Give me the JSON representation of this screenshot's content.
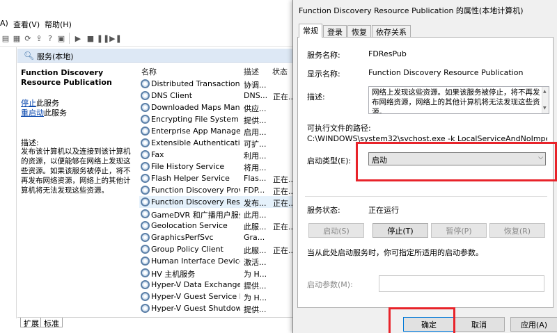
{
  "services_window": {
    "menu": {
      "partial": "A)",
      "view": "查看(V)",
      "help": "帮助(H)"
    },
    "panel_title": "服务(本地)",
    "selected_service": {
      "name": "Function Discovery Resource Publication",
      "stop_link": "停止",
      "stop_suffix": "此服务",
      "restart_link": "重启动",
      "restart_suffix": "此服务",
      "desc_label": "描述:",
      "description": "发布该计算机以及连接到该计算机的资源，以便能够在网络上发现这些资源。如果该服务被停止，将不再发布网络资源，网络上的其他计算机将无法发现这些资源。"
    },
    "columns": {
      "name": "名称",
      "desc": "描述",
      "status": "状态"
    },
    "rows": [
      {
        "name": "Distributed Transaction C...",
        "desc": "协调...",
        "status": ""
      },
      {
        "name": "DNS Client",
        "desc": "DNS...",
        "status": "正在..."
      },
      {
        "name": "Downloaded Maps Man...",
        "desc": "供应...",
        "status": ""
      },
      {
        "name": "Encrypting File System (E...",
        "desc": "提供...",
        "status": ""
      },
      {
        "name": "Enterprise App Manage...",
        "desc": "启用...",
        "status": ""
      },
      {
        "name": "Extensible Authenticati...",
        "desc": "可扩...",
        "status": ""
      },
      {
        "name": "Fax",
        "desc": "利用...",
        "status": ""
      },
      {
        "name": "File History Service",
        "desc": "将用...",
        "status": ""
      },
      {
        "name": "Flash Helper Service",
        "desc": "Flas...",
        "status": "正在..."
      },
      {
        "name": "Function Discovery Provi...",
        "desc": "FDP...",
        "status": "正在..."
      },
      {
        "name": "Function Discovery Reso...",
        "desc": "发布...",
        "status": "正在..."
      },
      {
        "name": "GameDVR 和广播用户服务...",
        "desc": "此用...",
        "status": ""
      },
      {
        "name": "Geolocation Service",
        "desc": "此服...",
        "status": "正在..."
      },
      {
        "name": "GraphicsPerfSvc",
        "desc": "Gra...",
        "status": ""
      },
      {
        "name": "Group Policy Client",
        "desc": "此服...",
        "status": "正在..."
      },
      {
        "name": "Human Interface Device ...",
        "desc": "激活...",
        "status": ""
      },
      {
        "name": "HV 主机服务",
        "desc": "为 H...",
        "status": ""
      },
      {
        "name": "Hyper-V Data Exchange ...",
        "desc": "提供...",
        "status": ""
      },
      {
        "name": "Hyper-V Guest Service In...",
        "desc": "为 H...",
        "status": ""
      },
      {
        "name": "Hyper-V Guest Shutdown...",
        "desc": "提供...",
        "status": ""
      }
    ],
    "bottom_tabs": {
      "extended": "扩展",
      "standard": "标准"
    }
  },
  "dialog": {
    "title": "Function Discovery Resource Publication 的属性(本地计算机)",
    "tabs": [
      "常规",
      "登录",
      "恢复",
      "依存关系"
    ],
    "service_name_label": "服务名称:",
    "service_name": "FDResPub",
    "display_name_label": "显示名称:",
    "display_name": "Function Discovery Resource Publication",
    "description_label": "描述:",
    "description": "网络上发现这些资源。如果该服务被停止，将不再发布网络资源，网络上的其他计算机将无法发现这些资源。",
    "exe_path_label": "可执行文件的路径:",
    "exe_path": "C:\\WINDOWS\\system32\\svchost.exe -k LocalServiceAndNoImpersonatic",
    "startup_type_label": "启动类型(E):",
    "startup_type": "启动",
    "status_label": "服务状态:",
    "status_value": "正在运行",
    "buttons": {
      "start": "启动(S)",
      "stop": "停止(T)",
      "pause": "暂停(P)",
      "resume": "恢复(R)"
    },
    "hint": "当从此处启动服务时，你可指定所适用的启动参数。",
    "params_label": "启动参数(M):",
    "params_value": "",
    "footer": {
      "ok": "确定",
      "cancel": "取消",
      "apply": "应用(A)"
    },
    "highlight_color": "#e8232a"
  }
}
